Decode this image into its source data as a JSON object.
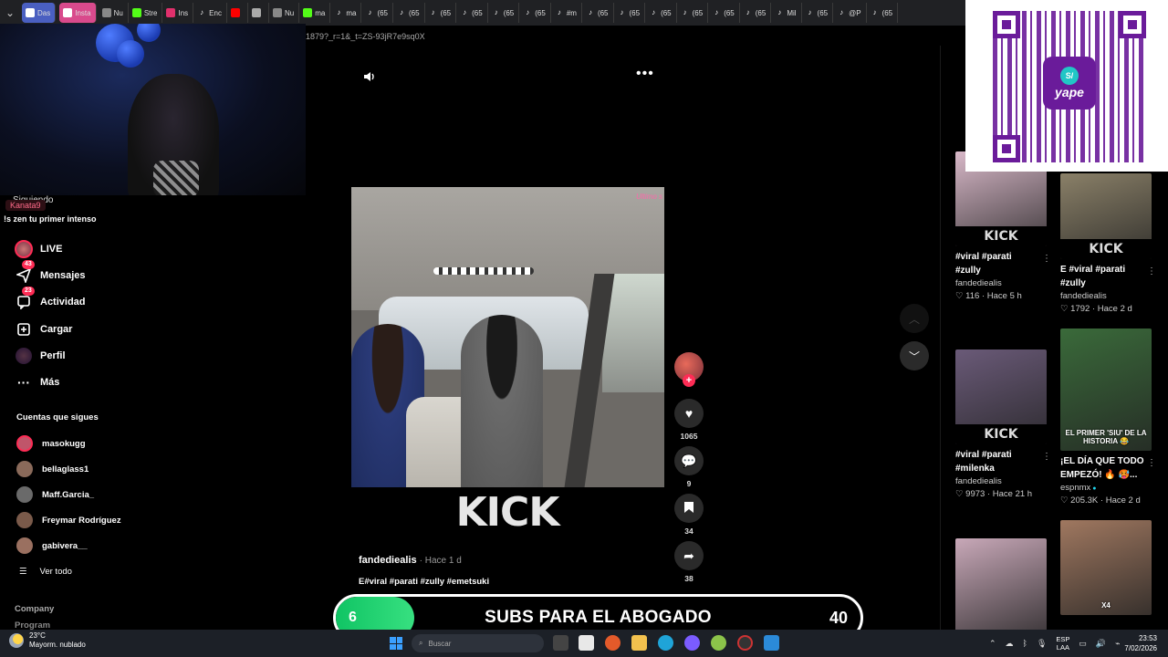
{
  "browser": {
    "tabs": [
      {
        "label": "Das",
        "icon": "app-icon",
        "style": "active"
      },
      {
        "label": "Insta",
        "icon": "app-icon",
        "style": "active2"
      },
      {
        "label": "Nu",
        "icon": "doc-icon"
      },
      {
        "label": "Stre",
        "icon": "kick-icon"
      },
      {
        "label": "Ins",
        "icon": "instagram-icon"
      },
      {
        "label": "Enc",
        "icon": "tiktok-icon"
      },
      {
        "label": "",
        "icon": "youtube-icon"
      },
      {
        "label": "",
        "icon": "speaker-icon"
      },
      {
        "label": "Nu",
        "icon": "doc-icon"
      },
      {
        "label": "ma",
        "icon": "kick-icon"
      },
      {
        "label": "ma",
        "icon": "tiktok-icon"
      },
      {
        "label": "(65",
        "icon": "tiktok-icon"
      },
      {
        "label": "(65",
        "icon": "tiktok-icon"
      },
      {
        "label": "(65",
        "icon": "tiktok-icon"
      },
      {
        "label": "(65",
        "icon": "tiktok-icon"
      },
      {
        "label": "(65",
        "icon": "tiktok-icon"
      },
      {
        "label": "(65",
        "icon": "tiktok-icon"
      },
      {
        "label": "#m",
        "icon": "tiktok-icon"
      },
      {
        "label": "(65",
        "icon": "tiktok-icon"
      },
      {
        "label": "(65",
        "icon": "tiktok-icon"
      },
      {
        "label": "(65",
        "icon": "tiktok-icon"
      },
      {
        "label": "(65",
        "icon": "tiktok-icon"
      },
      {
        "label": "(65",
        "icon": "tiktok-icon"
      },
      {
        "label": "(65",
        "icon": "tiktok-icon"
      },
      {
        "label": "Mil",
        "icon": "tiktok-icon"
      },
      {
        "label": "(65",
        "icon": "tiktok-icon"
      },
      {
        "label": "@P",
        "icon": "tiktok-icon"
      },
      {
        "label": "(65",
        "icon": "tiktok-icon"
      }
    ],
    "url": "1879?_r=1&_t=ZS-93jR7e9sq0X"
  },
  "sidebar": {
    "following_partial": "Siguiendo",
    "chat_user": "Kanata9",
    "chat_message": "!s zen tu primer intenso",
    "nav": [
      {
        "label": "LIVE",
        "icon": "live-avatar-icon",
        "badge": ""
      },
      {
        "label": "Mensajes",
        "icon": "send-icon",
        "badge": "43"
      },
      {
        "label": "Actividad",
        "icon": "activity-icon",
        "badge": "23"
      },
      {
        "label": "Cargar",
        "icon": "upload-icon",
        "badge": ""
      },
      {
        "label": "Perfil",
        "icon": "profile-avatar-icon",
        "badge": ""
      },
      {
        "label": "Más",
        "icon": "more-icon",
        "badge": ""
      }
    ],
    "following_title": "Cuentas que sigues",
    "accounts": [
      {
        "name": "masokugg",
        "color": "#c0556a"
      },
      {
        "name": "bellaglass1",
        "color": "#8a6a5a"
      },
      {
        "name": "Maff.Garcia_",
        "color": "#6a6a6a"
      },
      {
        "name": "Freymar Rodríguez",
        "color": "#7a5a4a"
      },
      {
        "name": "gabivera__",
        "color": "#9a7060"
      }
    ],
    "see_all": "Ver todo",
    "footer_company": "Company",
    "footer_program": "Program"
  },
  "video": {
    "kick_logo": "KICK",
    "watermark": "Ultimo s",
    "author": "fandediealis",
    "time": "· Hace 1 d",
    "caption": "E#viral #parati #zully #emetsuki",
    "likes": "1065",
    "comments": "9",
    "saves": "34",
    "shares": "38"
  },
  "recommendations": [
    {
      "title": "#viral #parati #zully",
      "author": "fandediealis",
      "likes": "116",
      "time": "Hace 5 h",
      "kick": "KICK",
      "verified": false,
      "thumb": "#d8b8c8"
    },
    {
      "title": "E #viral #parati #zully",
      "author": "fandediealis",
      "likes": "1792",
      "time": "Hace 2 d",
      "kick": "KICK",
      "verified": false,
      "thumb": "#8a8068"
    },
    {
      "title": "#viral #parati #milenka",
      "author": "fandediealis",
      "likes": "9973",
      "time": "Hace 21 h",
      "kick": "KICK",
      "verified": false,
      "thumb": "#6a5a78"
    },
    {
      "title": "¡EL DÍA QUE TODO EMPEZÓ! 🔥 🥵...",
      "author": "espnmx",
      "likes": "205.3K",
      "time": "Hace 2 d",
      "kick": "",
      "verified": true,
      "thumb": "#3a6a3a",
      "overlay": "EL PRIMER 'SIU' DE LA HISTORIA 😂"
    },
    {
      "title": "",
      "author": "",
      "likes": "",
      "time": "",
      "kick": "",
      "verified": false,
      "thumb": "#c8a8b8"
    },
    {
      "title": "",
      "author": "",
      "likes": "",
      "time": "",
      "kick": "",
      "verified": false,
      "thumb": "#a07860",
      "overlay": "X4"
    }
  ],
  "qr": {
    "brand": "yape",
    "icon": "qr-code-icon"
  },
  "subgoal": {
    "current": "6",
    "text": "SUBS PARA EL ABOGADO",
    "goal": "40",
    "progress_fraction": 0.15
  },
  "taskbar": {
    "temperature": "23°C",
    "weather": "Mayorm. nublado",
    "search_placeholder": "Buscar",
    "lang_1": "ESP",
    "lang_2": "LAA",
    "time": "23:53",
    "date": "7/02/2026"
  }
}
